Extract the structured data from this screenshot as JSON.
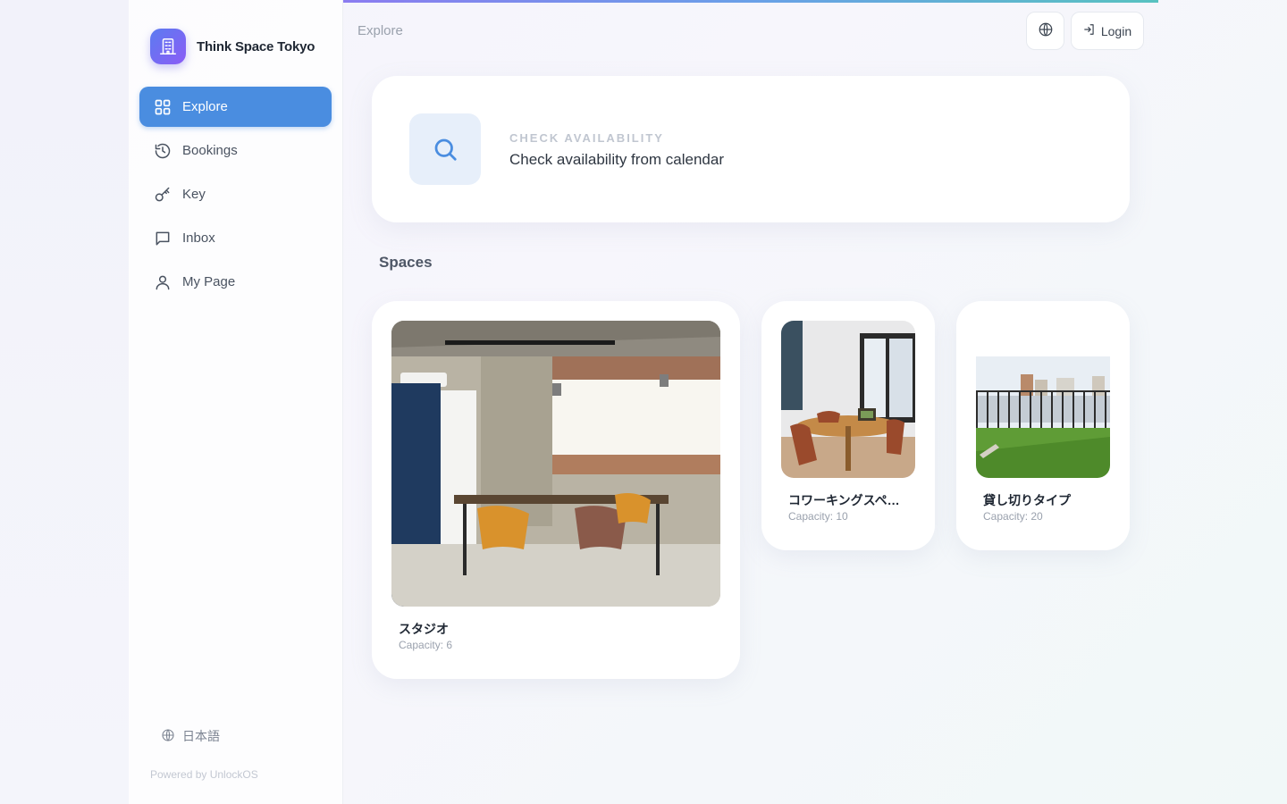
{
  "brand": {
    "name": "Think Space Tokyo",
    "logo_icon": "building-icon"
  },
  "nav": {
    "items": [
      {
        "label": "Explore",
        "icon": "grid-icon",
        "active": true
      },
      {
        "label": "Bookings",
        "icon": "history-icon",
        "active": false
      },
      {
        "label": "Key",
        "icon": "key-icon",
        "active": false
      },
      {
        "label": "Inbox",
        "icon": "message-icon",
        "active": false
      },
      {
        "label": "My Page",
        "icon": "user-icon",
        "active": false
      }
    ]
  },
  "footer": {
    "language_label": "日本語",
    "powered_by": "Powered by UnlockOS"
  },
  "header": {
    "breadcrumb": "Explore",
    "login_label": "Login"
  },
  "availability": {
    "eyebrow": "CHECK AVAILABILITY",
    "title": "Check availability from calendar"
  },
  "spaces": {
    "title": "Spaces",
    "items": [
      {
        "name": "スタジオ",
        "capacity": "Capacity: 6"
      },
      {
        "name": "コワーキングスペ…",
        "capacity": "Capacity: 10"
      },
      {
        "name": "貸し切りタイプ",
        "capacity": "Capacity: 20"
      }
    ]
  },
  "colors": {
    "accent": "#4a8de0",
    "brand_gradient_start": "#5b7cf0",
    "brand_gradient_end": "#8b5cf6"
  }
}
